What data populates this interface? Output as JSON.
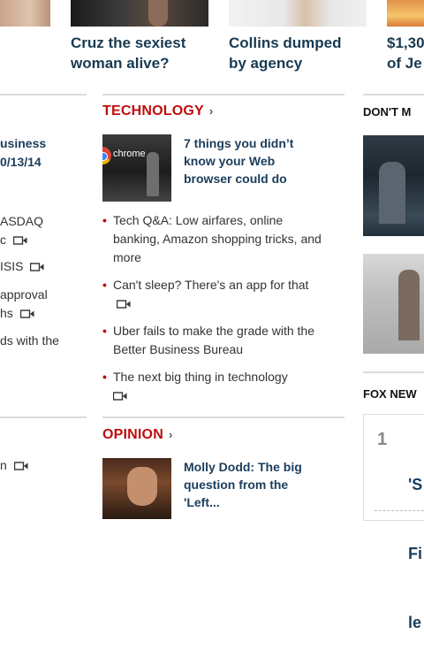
{
  "top_stories": [
    {
      "line1": "Cruz the sexiest",
      "line2": "woman alive?"
    },
    {
      "line1": "Collins dumped",
      "line2": "by agency"
    },
    {
      "line1": "$1,30",
      "line2": "of Je"
    }
  ],
  "left_column": {
    "items": [
      {
        "text": "usiness"
      },
      {
        "text": "0/13/14"
      },
      {
        "text": "ASDAQ"
      },
      {
        "text": "c",
        "video": true
      },
      {
        "text": "ISIS",
        "video": true
      },
      {
        "text": "approval"
      },
      {
        "text": "hs",
        "video": true
      },
      {
        "text": "ds with the"
      },
      {
        "text": "n",
        "video": true
      }
    ]
  },
  "technology": {
    "title": "TECHNOLOGY",
    "chevron": "›",
    "image_text": "chrome",
    "feature": "7 things you didn’t know your Web browser could do",
    "feature_lines": [
      "7 things you didn’t",
      "know your Web",
      "browser could do"
    ],
    "bullets": [
      {
        "text": "Tech Q&A: Low airfares, online banking, Amazon shopping tricks, and more",
        "video": false
      },
      {
        "text": "Can't sleep? There's an app for that",
        "video": true
      },
      {
        "text": "Uber fails to make the grade with the Better Business Bureau",
        "video": false
      },
      {
        "text": "The next big thing in technology",
        "video": true
      }
    ]
  },
  "opinion": {
    "title": "OPINION",
    "chevron": "›",
    "feature_lines": [
      "Molly Dodd: The big",
      "question from the",
      "'Left..."
    ]
  },
  "sidebar": {
    "dont_miss_title": "DON'T M",
    "fox_news_title": "FOX NEW",
    "trending": {
      "number": "1",
      "lines": [
        "'S",
        "Fi",
        "le"
      ]
    }
  },
  "colors": {
    "section_red": "#c00d0d",
    "headline_blue": "#183a52",
    "rule_gray": "#dcdcdc"
  }
}
